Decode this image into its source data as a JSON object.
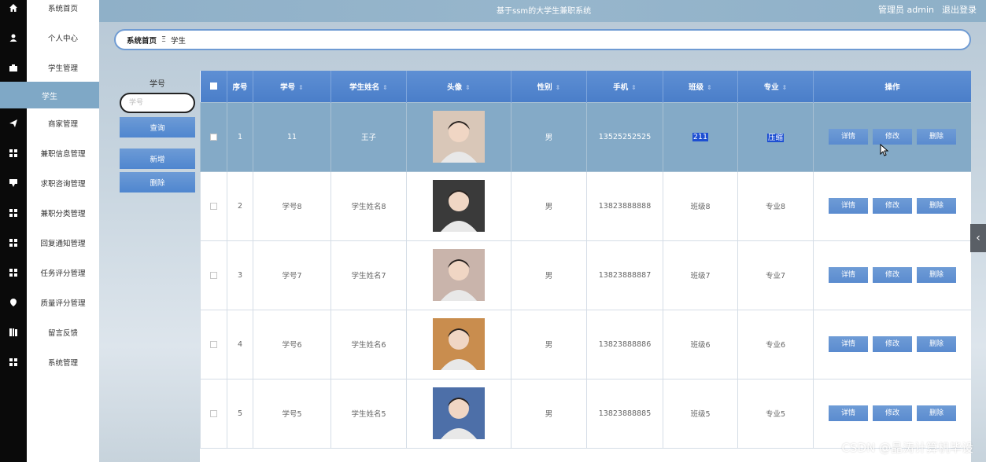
{
  "header": {
    "title": "基于ssm的大学生兼职系统",
    "user": "管理员 admin",
    "logout": "退出登录"
  },
  "sidebar": {
    "items": [
      {
        "label": "系统首页",
        "icon": "home-icon"
      },
      {
        "label": "个人中心",
        "icon": "user-icon"
      },
      {
        "label": "学生管理",
        "icon": "briefcase-icon"
      },
      {
        "label": "商家管理",
        "icon": "paper-plane-icon"
      },
      {
        "label": "兼职信息管理",
        "icon": "grid-icon"
      },
      {
        "label": "求职咨询管理",
        "icon": "chat-icon"
      },
      {
        "label": "兼职分类管理",
        "icon": "grid-icon"
      },
      {
        "label": "回复通知管理",
        "icon": "grid-icon"
      },
      {
        "label": "任务评分管理",
        "icon": "grid-icon"
      },
      {
        "label": "质量评分管理",
        "icon": "location-icon"
      },
      {
        "label": "留言反馈",
        "icon": "book-icon"
      },
      {
        "label": "系统管理",
        "icon": "grid-icon"
      }
    ],
    "active_sub": "学生"
  },
  "breadcrumb": {
    "home": "系统首页",
    "separator": "Ξ",
    "current": "学生"
  },
  "search": {
    "label": "学号",
    "placeholder": "学号",
    "query_button": "查询",
    "add_button": "新增",
    "delete_button": "删除"
  },
  "table": {
    "columns": [
      "序号",
      "学号",
      "学生姓名",
      "头像",
      "性别",
      "手机",
      "班级",
      "专业",
      "操作"
    ],
    "actions": {
      "detail": "详情",
      "edit": "修改",
      "delete": "删除"
    },
    "rows": [
      {
        "index": "1",
        "student_no": "11",
        "name": "王子",
        "gender": "男",
        "phone": "13525252525",
        "class": "211",
        "major": "压缩",
        "selected": true,
        "avatar_color": "#d9c7b8"
      },
      {
        "index": "2",
        "student_no": "学号8",
        "name": "学生姓名8",
        "gender": "男",
        "phone": "13823888888",
        "class": "班级8",
        "major": "专业8",
        "selected": false,
        "avatar_color": "#3a3a3a"
      },
      {
        "index": "3",
        "student_no": "学号7",
        "name": "学生姓名7",
        "gender": "男",
        "phone": "13823888887",
        "class": "班级7",
        "major": "专业7",
        "selected": false,
        "avatar_color": "#c9b4ab"
      },
      {
        "index": "4",
        "student_no": "学号6",
        "name": "学生姓名6",
        "gender": "男",
        "phone": "13823888886",
        "class": "班级6",
        "major": "专业6",
        "selected": false,
        "avatar_color": "#c98d4e"
      },
      {
        "index": "5",
        "student_no": "学号5",
        "name": "学生姓名5",
        "gender": "男",
        "phone": "13823888885",
        "class": "班级5",
        "major": "专业5",
        "selected": false,
        "avatar_color": "#4d6fa8"
      }
    ]
  },
  "watermark": "CSDN @晶涛计算机毕设",
  "colors": {
    "accent": "#4f86cf",
    "selected_row": "#84aac7",
    "header_bar": "#8fb0c8"
  }
}
